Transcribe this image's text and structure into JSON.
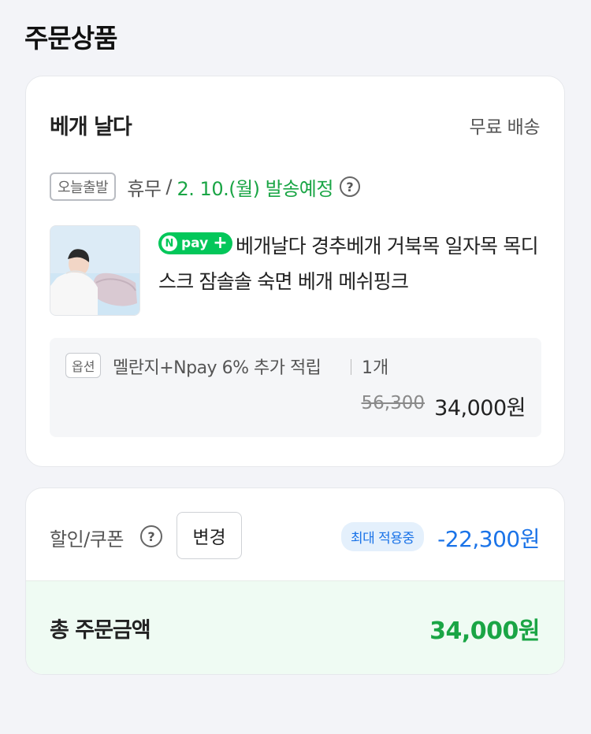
{
  "page": {
    "title": "주문상품"
  },
  "order": {
    "store_name": "베개 날다",
    "shipping_fee": "무료 배송",
    "shipping": {
      "today_tag": "오늘출발",
      "holiday": "휴무",
      "separator": "/",
      "date": "2. 10.(월) 발송예정",
      "help_icon": "?"
    },
    "product": {
      "image_icon": "pillow-product-image",
      "npay_badge": {
        "n": "N",
        "text": "pay",
        "plus": "+"
      },
      "name": "베개날다 경추베개 거북목 일자목 목디스크 잠솔솔 숙면 베개 메쉬핑크"
    },
    "option": {
      "tag": "옵션",
      "text": "멜란지+Npay 6% 추가 적립",
      "quantity": "1개",
      "original_price": "56,300",
      "sale_price": "34,000원"
    }
  },
  "price": {
    "discount_label": "할인/쿠폰",
    "help_icon": "?",
    "change_button": "변경",
    "max_badge": "최대 적용중",
    "discount_amount": "-22,300원",
    "total_label": "총 주문금액",
    "total_amount": "34,000원"
  },
  "colors": {
    "accent_green": "#1aa545",
    "accent_blue": "#1a73e8",
    "npay_green": "#03c75a"
  }
}
